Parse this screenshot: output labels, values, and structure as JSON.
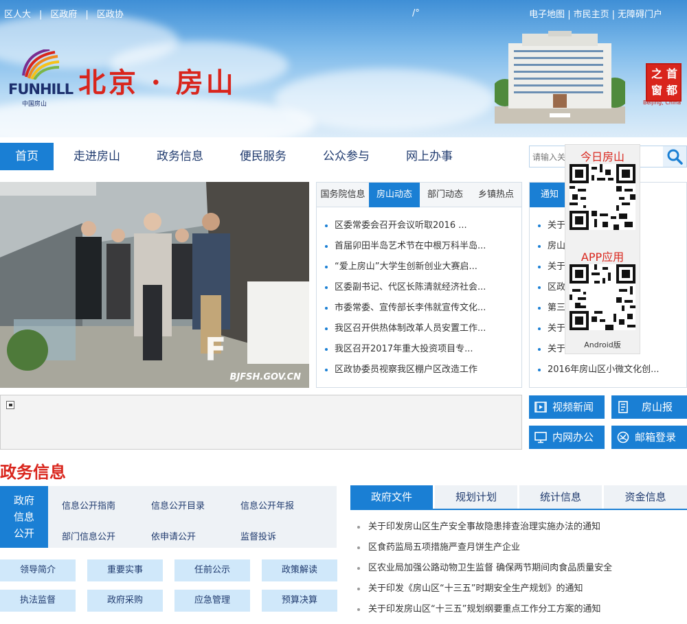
{
  "header": {
    "top_links": [
      "区人大",
      "区政府",
      "区政协"
    ],
    "top_sep": "|",
    "mid_mark": "/°",
    "right_links": [
      "电子地图",
      "市民主页",
      "无障碍门户"
    ],
    "logo_text": "FUNHILL",
    "logo_sub": "中国房山",
    "site_title": "北京 · 房山",
    "stamp_text": [
      "首",
      "都",
      "之",
      "窗"
    ],
    "stamp_caption": "Beijing, China"
  },
  "nav": {
    "items": [
      "首页",
      "走进房山",
      "政务信息",
      "便民服务",
      "公众参与",
      "网上办事"
    ],
    "active_index": 0
  },
  "search": {
    "placeholder": "请输入关"
  },
  "photo": {
    "caption": "BJFSH.GOV.CN"
  },
  "news": {
    "tabs": [
      "国务院信息",
      "房山动态",
      "部门动态",
      "乡镇热点"
    ],
    "active_index": 1,
    "items": [
      "区委常委会召开会议听取2016 ...",
      "首届卯田半岛艺术节在中根万科半岛...",
      "“爱上房山”大学生创新创业大赛启...",
      "区委副书记、代区长陈清就经济社会...",
      "市委常委、宣传部长李伟就宣传文化...",
      "我区召开供热体制改革人员安置工作...",
      "我区召开2017年重大投资项目专...",
      "区政协委员视察我区棚户区改造工作"
    ]
  },
  "notice": {
    "tab": "通知",
    "items": [
      "关于...校区修...",
      "房山...科委关...",
      "关于...资助工...",
      "区政...案线索...",
      "第三...装开幕",
      "关于...02...",
      "关于...引支...",
      "2016年房山区小微文化创..."
    ]
  },
  "qr": {
    "title1": "今日房山",
    "title2": "APP应用",
    "sub": "Android版",
    "logo_text": "FunHill"
  },
  "quick_buttons": [
    "视频新闻",
    "房山报",
    "内网办公",
    "邮箱登录"
  ],
  "section_title": "政务信息",
  "gov": {
    "label": [
      "政府",
      "信息",
      "公开"
    ],
    "links": [
      "信息公开指南",
      "信息公开目录",
      "信息公开年报",
      "部门信息公开",
      "依申请公开",
      "监督投诉"
    ]
  },
  "grid_buttons": [
    "领导简介",
    "重要实事",
    "任前公示",
    "政策解读",
    "执法监督",
    "政府采购",
    "应急管理",
    "预算决算"
  ],
  "docs": {
    "tabs": [
      "政府文件",
      "规划计划",
      "统计信息",
      "资金信息"
    ],
    "active_index": 0,
    "items": [
      "关于印发房山区生产安全事故隐患排查治理实施办法的通知",
      "区食药监局五项措施严查月饼生产企业",
      "区农业局加强公路动物卫生监督 确保两节期间肉食品质量安全",
      "关于印发《房山区“十三五”时期安全生产规划》的通知",
      "关于印发房山区“十三五”规划纲要重点工作分工方案的通知"
    ]
  },
  "colors": {
    "primary": "#1a7fd4",
    "title_red": "#d9251c",
    "nav_text": "#1f3a6e",
    "light_blue_btn": "#d0e8fa"
  }
}
